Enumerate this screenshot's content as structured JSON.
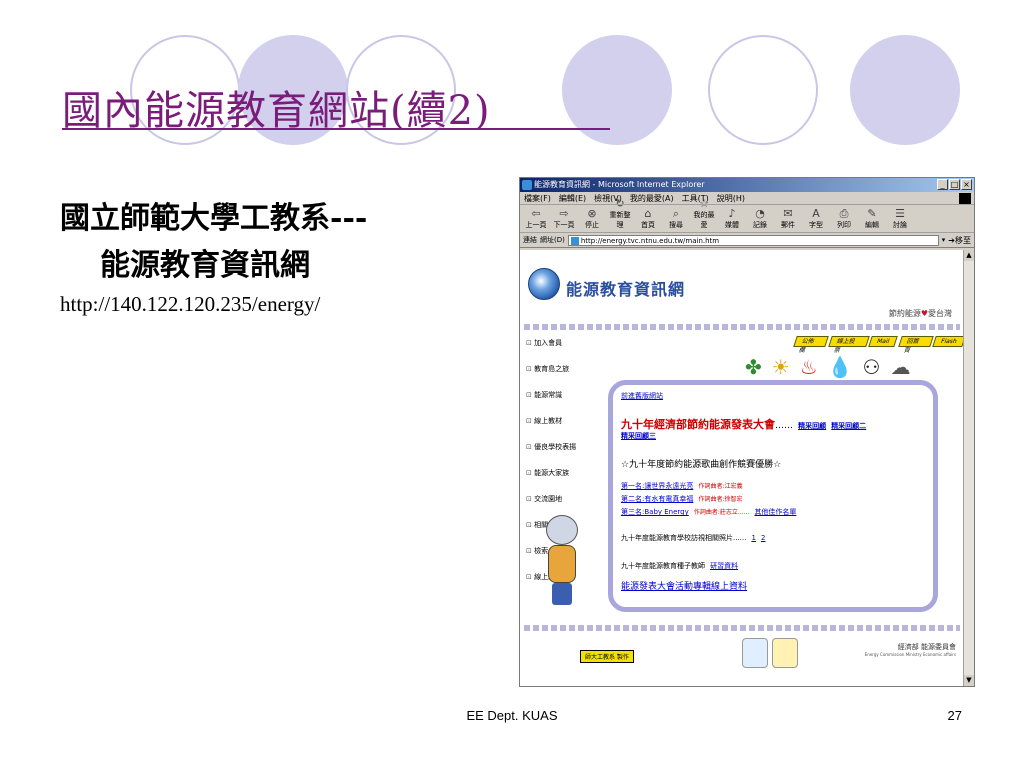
{
  "slide": {
    "title": "國內能源教育網站(續2)",
    "bullet_line1": "國立師範大學工教系---",
    "bullet_line2": "能源教育資訊網",
    "url": "http://140.122.120.235/energy/",
    "footer": "EE Dept. KUAS",
    "page_number": "27"
  },
  "browser": {
    "window_title": "能源教育資訊網 - Microsoft Internet Explorer",
    "menu": [
      "檔案(F)",
      "編輯(E)",
      "檢視(V)",
      "我的最愛(A)",
      "工具(T)",
      "說明(H)"
    ],
    "toolbar": [
      {
        "label": "上一頁",
        "icon": "back-arrow-icon",
        "glyph": "⇦"
      },
      {
        "label": "下一頁",
        "icon": "forward-arrow-icon",
        "glyph": "⇨"
      },
      {
        "label": "停止",
        "icon": "stop-icon",
        "glyph": "⊗"
      },
      {
        "label": "重新整理",
        "icon": "refresh-icon",
        "glyph": "↻"
      },
      {
        "label": "首頁",
        "icon": "home-icon",
        "glyph": "⌂"
      },
      {
        "label": "搜尋",
        "icon": "search-icon",
        "glyph": "⌕"
      },
      {
        "label": "我的最愛",
        "icon": "favorites-icon",
        "glyph": "☆"
      },
      {
        "label": "媒體",
        "icon": "media-icon",
        "glyph": "♪"
      },
      {
        "label": "記錄",
        "icon": "history-icon",
        "glyph": "◔"
      },
      {
        "label": "郵件",
        "icon": "mail-icon",
        "glyph": "✉"
      },
      {
        "label": "字型",
        "icon": "font-icon",
        "glyph": "A"
      },
      {
        "label": "列印",
        "icon": "print-icon",
        "glyph": "⎙"
      },
      {
        "label": "編輯",
        "icon": "edit-icon",
        "glyph": "✎"
      },
      {
        "label": "討論",
        "icon": "discuss-icon",
        "glyph": "☰"
      }
    ],
    "address_label": "網址(D)",
    "links_label": "連結",
    "address_value": "http://energy.tvc.ntnu.edu.tw/main.htm",
    "go_label": "移至"
  },
  "site": {
    "title": "能源教育資訊網",
    "slogan": "節約能源",
    "slogan_tail": "愛台灣",
    "nav": [
      "加入會員",
      "教育島之旅",
      "能源常識",
      "線上教材",
      "優良學校表揚",
      "能源大家族",
      "交流園地",
      "相關網站",
      "檢索",
      "線上調查"
    ],
    "top_tabs": [
      "公佈欄",
      "線上投票",
      "Mail",
      "回首頁",
      "Flash"
    ],
    "old_site_link": "前進舊版網站",
    "event_title": "九十年經濟部節約能源發表大會",
    "event_links": [
      "精采回顧",
      "精采回顧二",
      "精采回顧三"
    ],
    "contest_title": "☆九十年度節約能源歌曲創作競賽優勝☆",
    "winners": [
      {
        "place": "第一名:讓世界永遠光亮",
        "composer": "作詞曲者:江宏義"
      },
      {
        "place": "第二名:有水有電真幸福",
        "composer": "作詞曲者:徐智宏"
      },
      {
        "place": "第三名:Baby Energy",
        "composer": "作詞曲者:莊志立......",
        "more": "其他佳作名單"
      }
    ],
    "school_photos_text": "九十年度能源教育學校訪視相關照片......",
    "school_photo_links": [
      "1",
      "2"
    ],
    "teacher_text": "九十年度能源教育種子教師",
    "teacher_link": "研習資料",
    "conference_link": "能源發表大會活動專輯線上資料",
    "footer_badge": "師大工教系 製作",
    "ministry_name": "經濟部 能源委員會",
    "ministry_en": "Energy Commission Ministry Economic affairs"
  }
}
